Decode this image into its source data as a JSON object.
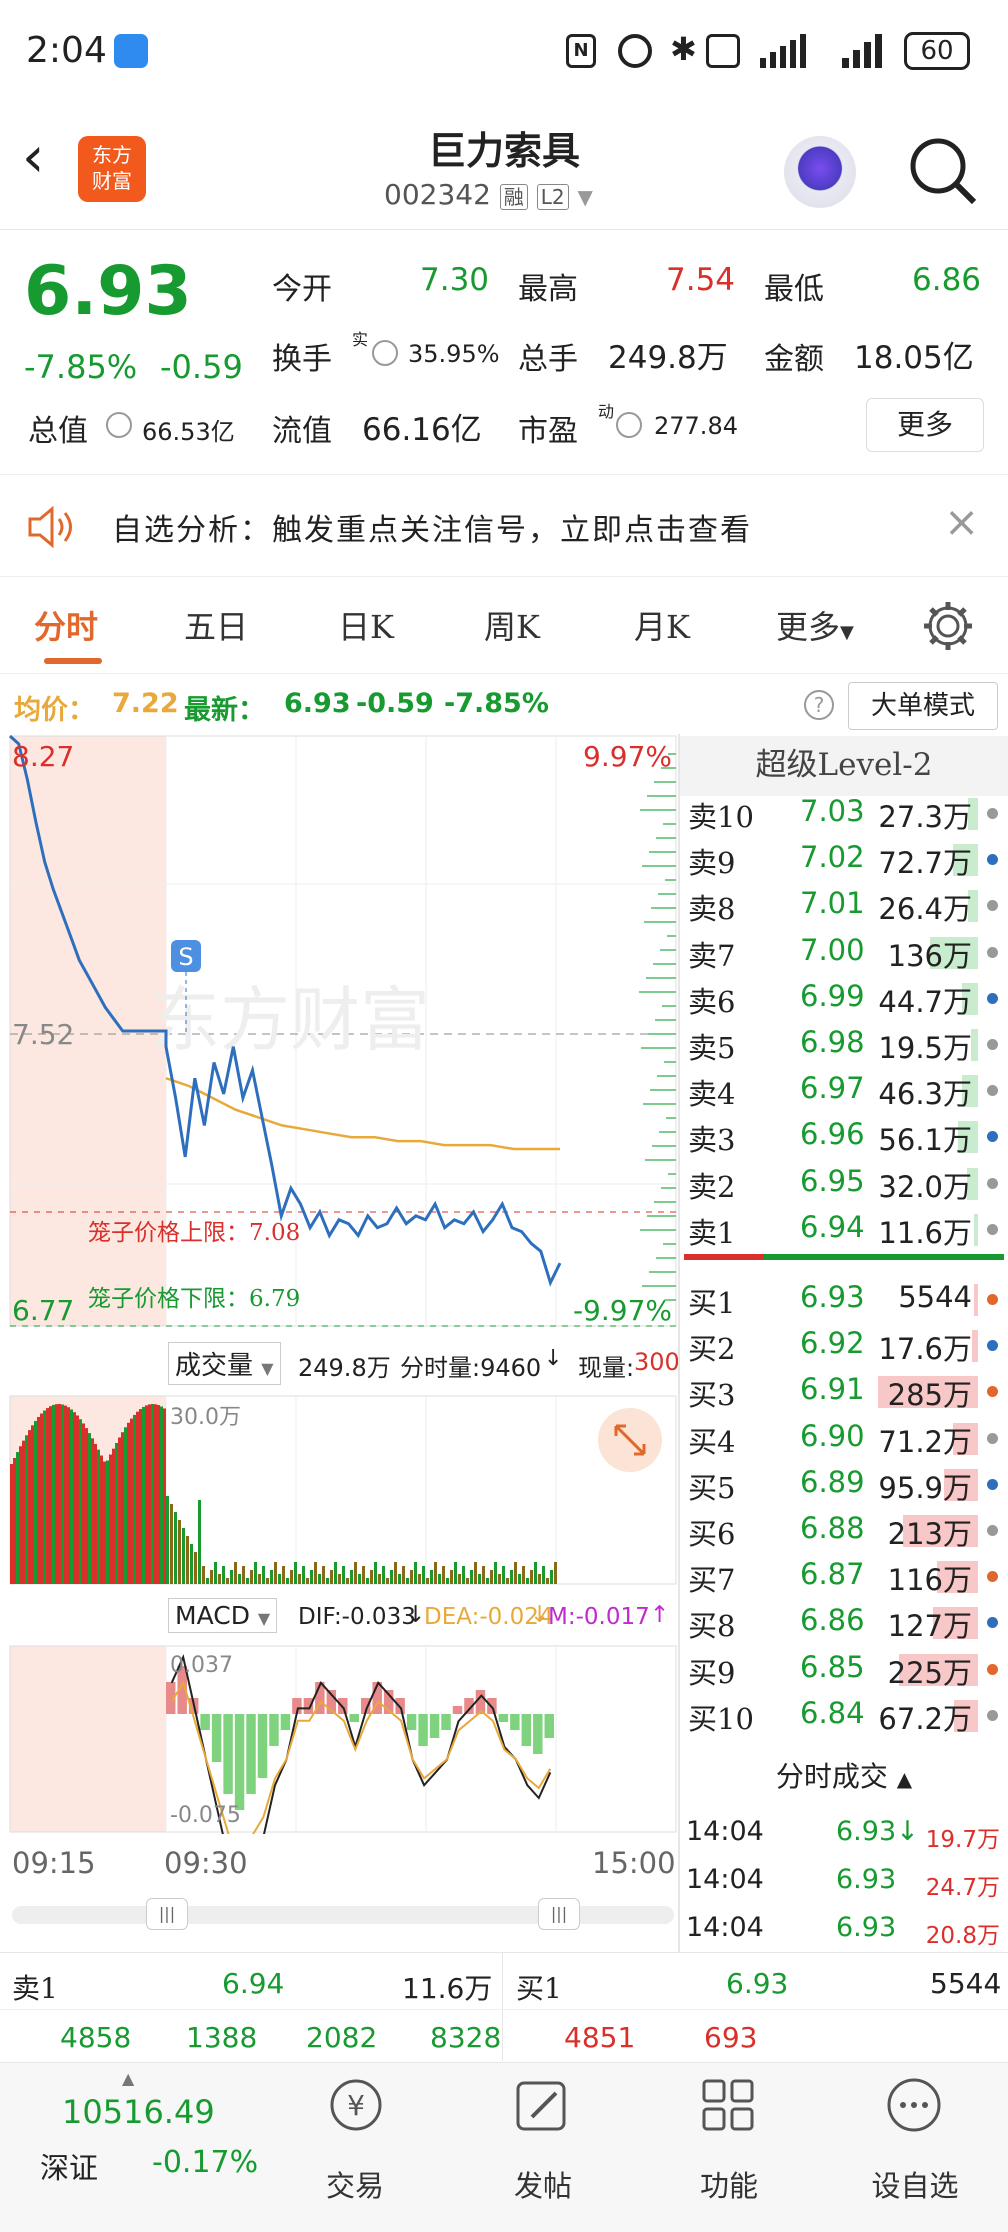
{
  "status_bar": {
    "time": "2:04",
    "battery": "60"
  },
  "header": {
    "title": "巨力索具",
    "code": "002342",
    "badge_rong": "融",
    "badge_l2": "L2",
    "logo_line1": "东方",
    "logo_line2": "财富"
  },
  "quote": {
    "price": "6.93",
    "change_pct": "-7.85%",
    "change": "-0.59",
    "open_label": "今开",
    "open": "7.30",
    "high_label": "最高",
    "high": "7.54",
    "low_label": "最低",
    "low": "6.86",
    "turnover_label": "换手",
    "turnover_sup": "实",
    "turnover": "35.95%",
    "volume_label": "总手",
    "volume": "249.8万",
    "amount_label": "金额",
    "amount": "18.05亿",
    "mktcap_label": "总值",
    "mktcap": "66.53亿",
    "float_label": "流值",
    "float": "66.16亿",
    "pe_label": "市盈",
    "pe_sup": "动",
    "pe": "277.84",
    "more": "更多"
  },
  "banner": {
    "text": "自选分析：触发重点关注信号，立即点击查看"
  },
  "tabs": [
    "分时",
    "五日",
    "日K",
    "周K",
    "月K",
    "更多"
  ],
  "info_bar": {
    "avg_label": "均价：",
    "avg": "7.22",
    "latest_label": "最新：",
    "latest": "6.93",
    "change": "-0.59",
    "change_pct": "-7.85%",
    "mode_btn": "大单模式"
  },
  "chart": {
    "y_top": "8.27",
    "y_mid": "7.52",
    "y_bot": "6.77",
    "pct_top": "9.97%",
    "pct_bot": "-9.97%",
    "upper_limit": "笼子价格上限：7.08",
    "lower_limit": "笼子价格下限：6.79",
    "watermark": "东方财富",
    "signal": "S",
    "price_color": "#2e6fbd",
    "avg_color": "#e8a93a",
    "price_line": [
      8.27,
      8.25,
      8.16,
      8.05,
      7.95,
      7.88,
      7.82,
      7.76,
      7.7,
      7.66,
      7.62,
      7.58,
      7.55,
      7.52,
      7.52,
      7.52,
      7.52,
      7.52,
      7.52,
      7.48,
      7.35,
      7.2,
      7.4,
      7.28,
      7.44,
      7.36,
      7.48,
      7.35,
      7.42,
      7.3,
      7.18,
      7.05,
      7.12,
      7.08,
      7.02,
      7.06,
      7.0,
      7.04,
      7.03,
      7.0,
      7.05,
      7.02,
      7.03,
      7.07,
      7.03,
      7.05,
      7.04,
      7.08,
      7.02,
      7.04,
      7.03,
      7.06,
      7.01,
      7.04,
      7.08,
      7.02,
      7.01,
      6.98,
      6.96,
      6.88,
      6.93
    ],
    "avg_line": [
      7.4,
      7.38,
      7.35,
      7.32,
      7.3,
      7.28,
      7.27,
      7.26,
      7.25,
      7.25,
      7.24,
      7.24,
      7.23,
      7.23,
      7.23,
      7.22,
      7.22,
      7.22
    ]
  },
  "volume_panel": {
    "label": "成交量",
    "total": "249.8万",
    "fenshi_label": "分时量:9460",
    "current_label": "现量:",
    "current": "300",
    "scale": "30.0万"
  },
  "macd_panel": {
    "label": "MACD",
    "dif": "DIF:-0.033",
    "dea": "DEA:-0.024",
    "m": "M:-0.017",
    "top": "0.037",
    "bot": "-0.075",
    "bars": [
      0.02,
      0.03,
      0.01,
      -0.01,
      -0.03,
      -0.05,
      -0.06,
      -0.05,
      -0.04,
      -0.02,
      -0.01,
      0.01,
      0.01,
      0.02,
      0.015,
      0.01,
      -0.005,
      0.01,
      0.02,
      0.015,
      0.01,
      -0.01,
      -0.02,
      -0.015,
      -0.01,
      0.005,
      0.01,
      0.015,
      0.01,
      -0.005,
      -0.01,
      -0.02,
      -0.025,
      -0.015
    ]
  },
  "time_axis": {
    "start": "09:15",
    "open": "09:30",
    "end": "15:00"
  },
  "level2": {
    "title": "超级Level-2",
    "asks": [
      {
        "label": "卖10",
        "price": "7.03",
        "vol": "27.3万",
        "bar": 0.1
      },
      {
        "label": "卖9",
        "price": "7.02",
        "vol": "72.7万",
        "bar": 0.25
      },
      {
        "label": "卖8",
        "price": "7.01",
        "vol": "26.4万",
        "bar": 0.1
      },
      {
        "label": "卖7",
        "price": "7.00",
        "vol": "136万",
        "bar": 0.48
      },
      {
        "label": "卖6",
        "price": "6.99",
        "vol": "44.7万",
        "bar": 0.16
      },
      {
        "label": "卖5",
        "price": "6.98",
        "vol": "19.5万",
        "bar": 0.07
      },
      {
        "label": "卖4",
        "price": "6.97",
        "vol": "46.3万",
        "bar": 0.16
      },
      {
        "label": "卖3",
        "price": "6.96",
        "vol": "56.1万",
        "bar": 0.2
      },
      {
        "label": "卖2",
        "price": "6.95",
        "vol": "32.0万",
        "bar": 0.11
      },
      {
        "label": "卖1",
        "price": "6.94",
        "vol": "11.6万",
        "bar": 0.04
      }
    ],
    "bids": [
      {
        "label": "买1",
        "price": "6.93",
        "vol": "5544",
        "bar": 0.0
      },
      {
        "label": "买2",
        "price": "6.92",
        "vol": "17.6万",
        "bar": 0.06
      },
      {
        "label": "买3",
        "price": "6.91",
        "vol": "285万",
        "bar": 1.0
      },
      {
        "label": "买4",
        "price": "6.90",
        "vol": "71.2万",
        "bar": 0.25
      },
      {
        "label": "买5",
        "price": "6.89",
        "vol": "95.9万",
        "bar": 0.34
      },
      {
        "label": "买6",
        "price": "6.88",
        "vol": "213万",
        "bar": 0.75
      },
      {
        "label": "买7",
        "price": "6.87",
        "vol": "116万",
        "bar": 0.41
      },
      {
        "label": "买8",
        "price": "6.86",
        "vol": "127万",
        "bar": 0.45
      },
      {
        "label": "买9",
        "price": "6.85",
        "vol": "225万",
        "bar": 0.79
      },
      {
        "label": "买10",
        "price": "6.84",
        "vol": "67.2万",
        "bar": 0.24
      }
    ],
    "ticks_title": "分时成交",
    "ticks": [
      {
        "time": "14:04",
        "price": "6.93",
        "arrow": "↓",
        "vol": "19.7万"
      },
      {
        "time": "14:04",
        "price": "6.93",
        "arrow": "",
        "vol": "24.7万"
      },
      {
        "time": "14:04",
        "price": "6.93",
        "arrow": "",
        "vol": "20.8万"
      }
    ]
  },
  "book_summary": {
    "ask1_label": "卖1",
    "ask1_price": "6.94",
    "ask1_vol": "11.6万",
    "bid1_label": "买1",
    "bid1_price": "6.93",
    "bid1_vol": "5544",
    "ask_split": [
      "4858",
      "1388",
      "2082",
      "8328"
    ],
    "bid_split": [
      "4851",
      "693"
    ]
  },
  "bottom_nav": {
    "index_value": "10516.49",
    "index_name": "深证",
    "index_change": "-0.17%",
    "items": [
      "交易",
      "发帖",
      "功能",
      "设自选"
    ]
  }
}
